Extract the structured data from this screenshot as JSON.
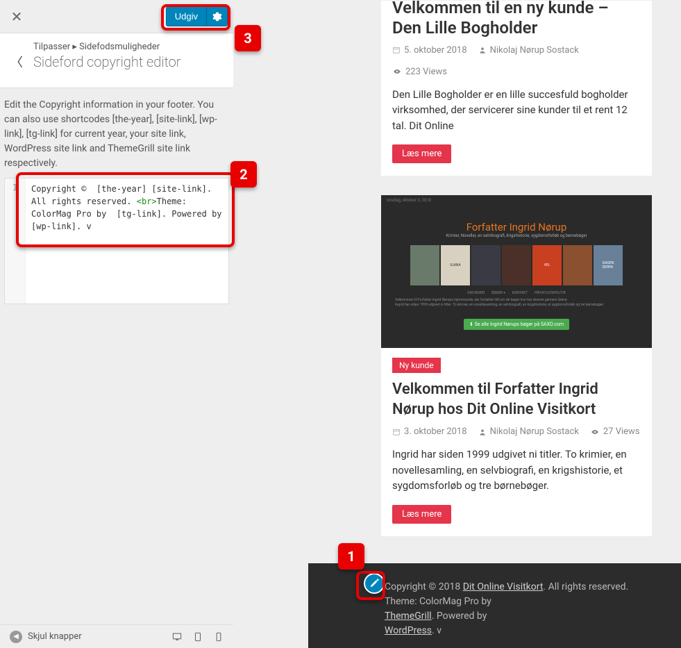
{
  "customizer": {
    "publish_label": "Udgiv",
    "breadcrumb_root": "Tilpasser",
    "breadcrumb_sep": "▸",
    "breadcrumb_section": "Sidefodsmuligheder",
    "section_title": "Sideford copyright editor",
    "description": "Edit the Copyright information in your footer. You can also use shortcodes [the-year], [site-link], [wp-link], [tg-link] for current year, your site link, WordPress site link and ThemeGrill site link respectively.",
    "code_line_number": "1",
    "code_pre": "Copyright ©  [the-year] [site-link]. All rights reserved. ",
    "code_tag": "<br>",
    "code_post": "Theme: ColorMag Pro by  [tg-link]. Powered by  [wp-link]. v",
    "collapse_label": "Skjul knapper"
  },
  "preview": {
    "post1": {
      "title": "Velkommen til en ny kunde – Den Lille Bogholder",
      "date": "5. oktober 2018",
      "author": "Nikolaj Nørup Sostack",
      "views": "223 Views",
      "excerpt": "Den Lille Bogholder er en lille succesfuld bogholder virksomhed, der servicerer sine kunder til et rent 12 tal. Dit Online",
      "read_more": "Læs mere"
    },
    "post2": {
      "category": "Ny kunde",
      "img_title": "Forfatter Ingrid Nørup",
      "img_sub": "Krimier, Noveller, en selvbiografi, krigshistorie, sygdomsforløb og børnebøger",
      "img_cta": "⬇ Se alle Ingrid Nørups bøger på SAXO.com",
      "title": "Velkommen til Forfatter Ingrid Nørup hos Dit Online Visitkort",
      "date": "3. oktober 2018",
      "author": "Nikolaj Nørup Sostack",
      "views": "27 Views",
      "excerpt": "Ingrid har siden 1999 udgivet ni titler. To krimier, en novellesamling, en selvbiografi, en krigshistorie, et sygdomsforløb og tre børnebøger.",
      "read_more": "Læs mere"
    },
    "footer": {
      "l1a": "Copyright © 2018 ",
      "l1b": "Dit Online Visitkort",
      "l1c": ". All rights reserved.",
      "l2a": "Theme: ColorMag Pro by ",
      "l2b": "ThemeGrill",
      "l2c": ". Powered by ",
      "l2d": "WordPress",
      "l2e": ". v"
    }
  },
  "annotations": {
    "n1": "1",
    "n2": "2",
    "n3": "3"
  }
}
